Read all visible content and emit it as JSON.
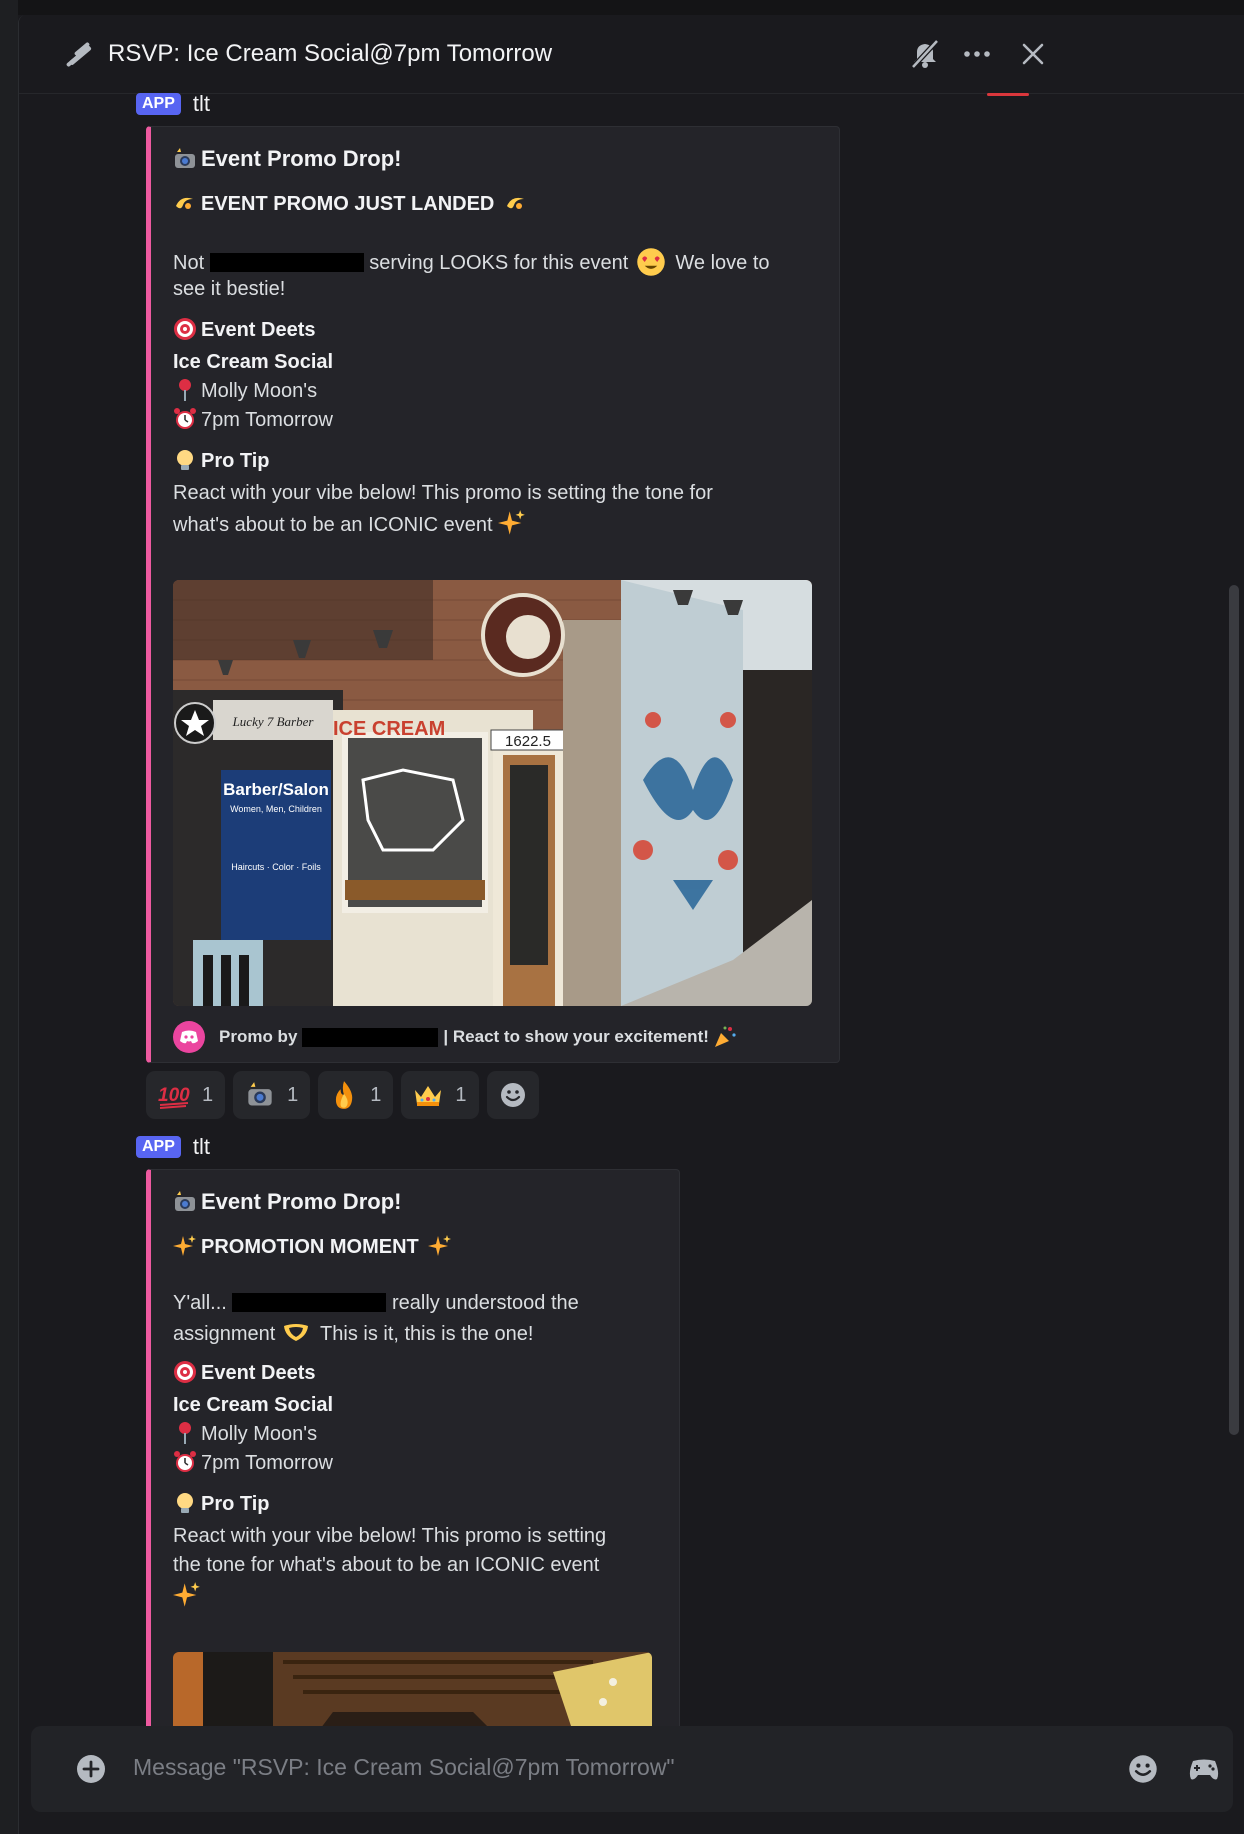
{
  "header": {
    "title": "RSVP: Ice Cream Social@7pm Tomorrow",
    "icons": [
      "thread-icon",
      "mute-bell-icon",
      "more-icon",
      "close-icon"
    ]
  },
  "messages": [
    {
      "tag": "APP",
      "author": "tlt",
      "embed": {
        "title": "Event Promo Drop!",
        "subtitle": "EVENT PROMO JUST LANDED",
        "desc_pre": "Not",
        "desc_post": "serving LOOKS for this event",
        "desc_tail": "We love to",
        "desc_line2": "see it bestie!",
        "deets_heading": "Event Deets",
        "event_name": "Ice Cream Social",
        "location": "Molly Moon's",
        "time": "7pm Tomorrow",
        "tip_heading": "Pro Tip",
        "tip_line1": "React with your vibe below! This promo is setting the tone for",
        "tip_line2": "what's about to be an ICONIC event",
        "footer_pre": "Promo by",
        "footer_post": "| React to show your excitement!"
      },
      "reactions": [
        {
          "emoji": "hundred-points",
          "count": "1"
        },
        {
          "emoji": "camera-flash",
          "count": "1"
        },
        {
          "emoji": "fire",
          "count": "1"
        },
        {
          "emoji": "crown",
          "count": "1"
        }
      ]
    },
    {
      "tag": "APP",
      "author": "tlt",
      "embed": {
        "title": "Event Promo Drop!",
        "subtitle": "PROMOTION MOMENT",
        "desc_pre": "Y'all...",
        "desc_post": "really understood the",
        "desc_line2": "assignment",
        "desc_line2_tail": "This is it, this is the one!",
        "deets_heading": "Event Deets",
        "event_name": "Ice Cream Social",
        "location": "Molly Moon's",
        "time": "7pm Tomorrow",
        "tip_heading": "Pro Tip",
        "tip_line1": "React with your vibe below! This promo is setting",
        "tip_line2": "the tone for what's about to be an ICONIC event"
      }
    }
  ],
  "photo_text": {
    "sign_ice_cream": "ICE CREAM",
    "sign_barber": "Barber/Salon",
    "sign_barber_sub": "Women, Men, Children",
    "sign_services": "Haircuts · Color · Foils",
    "address": "1622.5",
    "barber_name": "Lucky 7 Barber"
  },
  "composer": {
    "placeholder": "Message \"RSVP: Ice Cream Social@7pm Tomorrow\""
  },
  "colors": {
    "accent": "#5865f2",
    "embed_border": "#ee5aa0",
    "background": "#1a1a1e"
  }
}
